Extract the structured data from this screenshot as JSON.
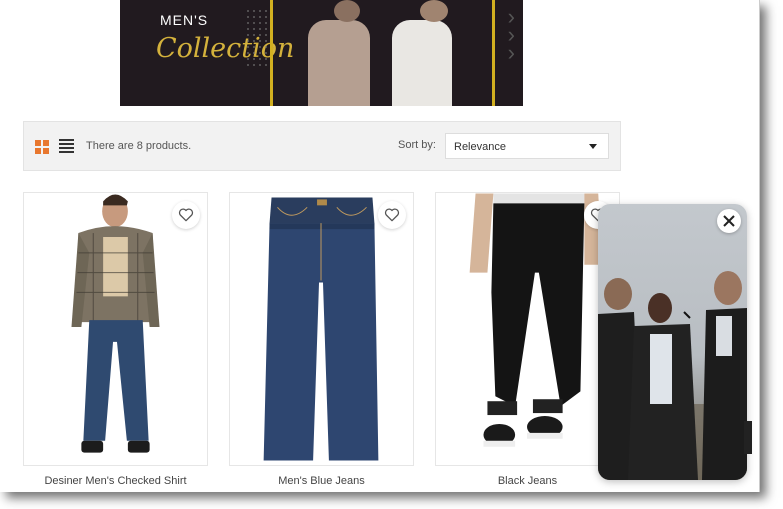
{
  "banner": {
    "line1": "MEN'S",
    "line2": "Collection"
  },
  "toolbar": {
    "grid_icon": "grid-view-icon",
    "list_icon": "list-view-icon",
    "product_count": "There are 8 products.",
    "sort_label": "Sort by:",
    "sort_value": "Relevance",
    "accent_color": "#e8772e"
  },
  "products": [
    {
      "name": "Desiner Men's Checked Shirt",
      "wishlist_icon": "heart-outline-icon"
    },
    {
      "name": "Men's Blue Jeans",
      "wishlist_icon": "heart-outline-icon"
    },
    {
      "name": "Black Jeans",
      "wishlist_icon": "heart-outline-icon"
    }
  ],
  "popup": {
    "close_icon": "close-icon"
  }
}
